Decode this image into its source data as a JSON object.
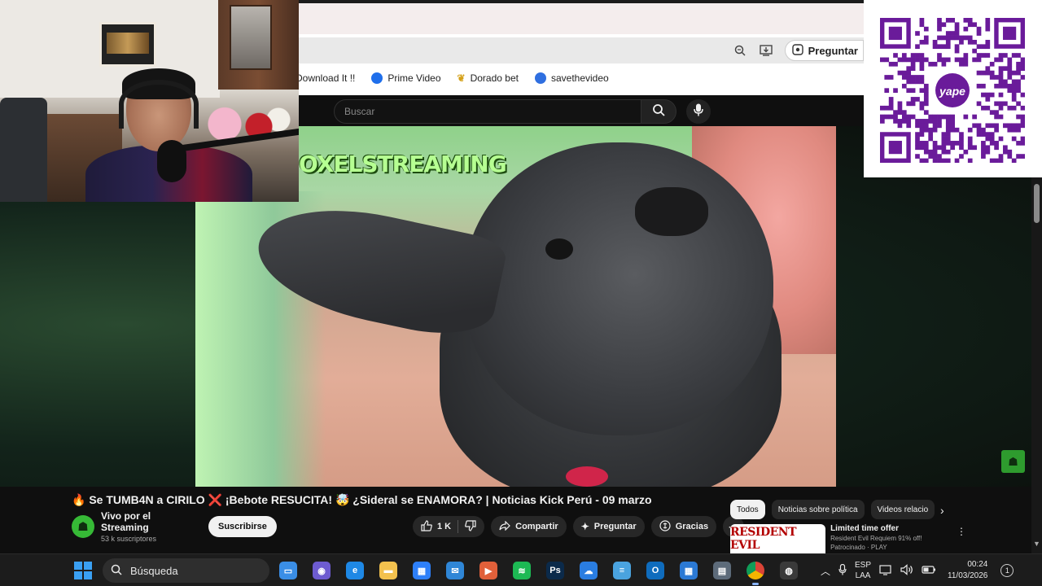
{
  "browser": {
    "ask_label": "Preguntar",
    "bookmarks": [
      {
        "label": "Download It !!",
        "icon": "download-icon",
        "color": "#ffffff"
      },
      {
        "label": "Prime Video",
        "icon": "prime-video-icon",
        "color": "#1f6feb"
      },
      {
        "label": "Dorado bet",
        "icon": "dorado-bet-icon",
        "color": "#d4a017"
      },
      {
        "label": "savethevideo",
        "icon": "savethevideo-icon",
        "color": "#2f6fe0"
      }
    ]
  },
  "youtube": {
    "search_placeholder": "Buscar",
    "video_overlay_text": "OXELSTREAMING",
    "title": "🔥 Se TUMB4N a CIRILO ❌ ¡Bebote RESUCITA! 🤯 ¿Sideral se ENAMORA? | Noticias Kick Perú - 09 marzo",
    "channel": {
      "name": "Vivo por el Streaming",
      "subscribers": "53 k suscriptores",
      "subscribe_label": "Suscribirse"
    },
    "actions": {
      "likes": "1 K",
      "share": "Compartir",
      "ask": "Preguntar",
      "thanks": "Gracias"
    },
    "chips": [
      "Todos",
      "Noticias sobre política",
      "Videos relacio"
    ],
    "recommendation": {
      "thumb_text": "RESIDENT EVIL",
      "title": "Limited time offer",
      "subtitle": "Resident Evil Requiem 91% off!",
      "sponsored": "Patrocinado · PLAY"
    }
  },
  "qr": {
    "brand_text": "yape"
  },
  "taskbar": {
    "search_label": "Búsqueda",
    "apps": [
      "file-manager-icon",
      "copilot-icon",
      "edge-icon",
      "folder-icon",
      "store-icon",
      "mail-icon",
      "media-icon",
      "spotify-icon",
      "photoshop-icon",
      "onedrive-icon",
      "notepad-icon",
      "outlook-icon",
      "calendar-icon",
      "calculator-icon",
      "chrome-icon",
      "obs-icon"
    ],
    "lang_top": "ESP",
    "lang_bottom": "LAA",
    "time": "00:24",
    "date": "11/03/2026",
    "notifications": "1"
  },
  "colors": {
    "yt_bg": "#0f0f0f",
    "accent_green": "#36b936",
    "qr_purple": "#6a1b9a"
  }
}
